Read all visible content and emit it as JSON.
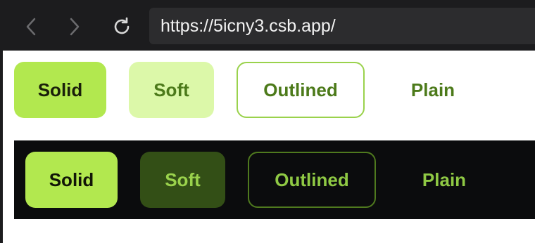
{
  "browser": {
    "url": "https://5icny3.csb.app/",
    "icons": [
      "chevron-left-icon",
      "chevron-right-icon",
      "reload-icon"
    ]
  },
  "light_row": {
    "solid": "Solid",
    "soft": "Soft",
    "outlined": "Outlined",
    "plain": "Plain"
  },
  "dark_row": {
    "solid": "Solid",
    "soft": "Soft",
    "outlined": "Outlined",
    "plain": "Plain"
  },
  "colors": {
    "accent": "#b2e84f",
    "soft_light": "#dcf8a9",
    "soft_dark": "#334f16",
    "text_green": "#4c7a1a",
    "dark_bg": "#0b0c0d"
  }
}
